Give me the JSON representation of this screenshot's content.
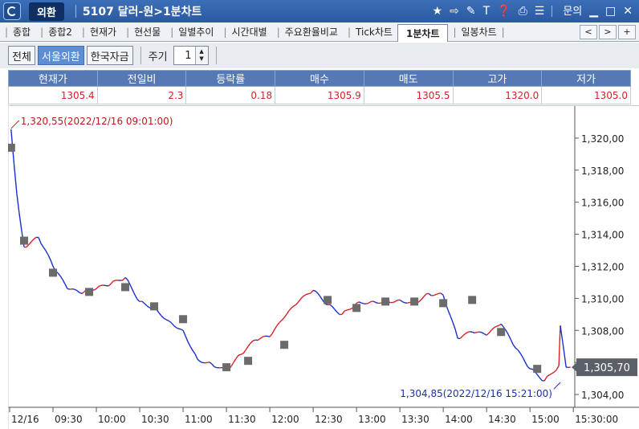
{
  "window": {
    "badge": "외환",
    "title": "5107 달러-원>1분차트",
    "menu_label": "문의",
    "icons": [
      "star-icon",
      "export-icon",
      "link-icon",
      "text-icon",
      "help-icon",
      "print-icon",
      "list-icon"
    ]
  },
  "tabs": [
    {
      "label": "종합",
      "active": false
    },
    {
      "label": "종합2",
      "active": false
    },
    {
      "label": "현재가",
      "active": false
    },
    {
      "label": "현선물",
      "active": false
    },
    {
      "label": "일별추이",
      "active": false
    },
    {
      "label": "시간대별",
      "active": false
    },
    {
      "label": "주요환율비교",
      "active": false
    },
    {
      "label": "Tick차트",
      "active": false
    },
    {
      "label": "1분차트",
      "active": true
    },
    {
      "label": "일봉차트",
      "active": false
    }
  ],
  "tab_nav": {
    "prev": "<",
    "next": ">",
    "add": "+"
  },
  "toolbar": {
    "buttons": [
      {
        "label": "전체",
        "active": false
      },
      {
        "label": "서울외환",
        "active": true
      },
      {
        "label": "한국자금",
        "active": false
      }
    ],
    "period_label": "주기",
    "period_value": "1"
  },
  "quote": {
    "headers": [
      "현재가",
      "전일비",
      "등락률",
      "매수",
      "매도",
      "고가",
      "저가"
    ],
    "values": [
      "1305.4",
      "2.3",
      "0.18",
      "1305.9",
      "1305.5",
      "1320.0",
      "1305.0"
    ]
  },
  "chart_data": {
    "type": "line",
    "x": [
      "09:01",
      "09:05",
      "09:10",
      "09:20",
      "09:30",
      "09:40",
      "09:50",
      "10:00",
      "10:10",
      "10:20",
      "10:30",
      "10:40",
      "10:50",
      "11:00",
      "11:10",
      "11:20",
      "11:30",
      "11:40",
      "11:50",
      "12:00",
      "12:10",
      "12:20",
      "12:30",
      "12:40",
      "12:50",
      "13:00",
      "13:10",
      "13:20",
      "13:30",
      "13:40",
      "13:50",
      "14:00",
      "14:10",
      "14:20",
      "14:30",
      "14:40",
      "14:50",
      "15:00",
      "15:10",
      "15:20",
      "15:21",
      "15:25",
      "15:28"
    ],
    "values": [
      1320.55,
      1316.5,
      1313.2,
      1313.8,
      1312.0,
      1310.6,
      1310.3,
      1310.6,
      1310.9,
      1311.3,
      1309.8,
      1309.4,
      1308.6,
      1308.0,
      1306.2,
      1305.9,
      1305.5,
      1306.5,
      1307.4,
      1307.6,
      1308.8,
      1309.8,
      1310.5,
      1309.6,
      1309.0,
      1309.7,
      1309.8,
      1309.8,
      1309.9,
      1309.7,
      1310.3,
      1310.2,
      1307.5,
      1307.9,
      1307.7,
      1308.4,
      1306.9,
      1305.6,
      1304.85,
      1305.8,
      1308.3,
      1305.7,
      1305.7
    ],
    "markers": [
      {
        "x": "09:01",
        "value": 1319.4
      },
      {
        "x": "09:10",
        "value": 1313.6
      },
      {
        "x": "09:30",
        "value": 1311.6
      },
      {
        "x": "09:55",
        "value": 1310.4
      },
      {
        "x": "10:20",
        "value": 1310.7
      },
      {
        "x": "10:40",
        "value": 1309.5
      },
      {
        "x": "11:00",
        "value": 1308.7
      },
      {
        "x": "11:30",
        "value": 1305.7
      },
      {
        "x": "11:45",
        "value": 1306.1
      },
      {
        "x": "12:10",
        "value": 1307.1
      },
      {
        "x": "12:40",
        "value": 1309.9
      },
      {
        "x": "13:00",
        "value": 1309.4
      },
      {
        "x": "13:20",
        "value": 1309.8
      },
      {
        "x": "13:40",
        "value": 1309.8
      },
      {
        "x": "14:00",
        "value": 1309.7
      },
      {
        "x": "14:20",
        "value": 1309.9
      },
      {
        "x": "14:40",
        "value": 1307.9
      },
      {
        "x": "15:05",
        "value": 1305.6
      }
    ],
    "ylim": [
      1303.2,
      1321.7
    ],
    "xlim": [
      "09:00",
      "15:31"
    ],
    "yticks": [
      1304.0,
      1306.0,
      1308.0,
      1310.0,
      1312.0,
      1314.0,
      1316.0,
      1318.0,
      1320.0
    ],
    "ytick_labels": [
      "1,304,00",
      "1,306,00",
      "1,308,00",
      "1,310,00",
      "1,312,00",
      "1,314,00",
      "1,316,00",
      "1,318,00",
      "1,320,00"
    ],
    "xticks": [
      "09:00",
      "09:30",
      "10:00",
      "10:30",
      "11:00",
      "11:30",
      "12:00",
      "12:30",
      "13:00",
      "13:30",
      "14:00",
      "14:30",
      "15:00",
      "15:30"
    ],
    "xtick_labels": [
      "12/16",
      "09:30",
      "10:00",
      "10:30",
      "11:00",
      "11:30",
      "12:00",
      "12:30",
      "13:00",
      "13:30",
      "14:00",
      "14:30",
      "15:00",
      "15:30:00"
    ],
    "current_value": 1305.7,
    "current_label": "1,305,70",
    "high": {
      "x": "09:01",
      "value": 1320.55,
      "label": "1,320,55(2022/12/16 09:01:00)"
    },
    "low": {
      "x": "15:21",
      "value": 1304.85,
      "label": "1,304,85(2022/12/16 15:21:00)"
    },
    "colors": {
      "up": "#d8202a",
      "down": "#1a2fd0",
      "marker": "#6b6b6b",
      "high": "#c21818",
      "low": "#1a2fb0",
      "current_box": "#5a5f68"
    },
    "grid": false
  }
}
